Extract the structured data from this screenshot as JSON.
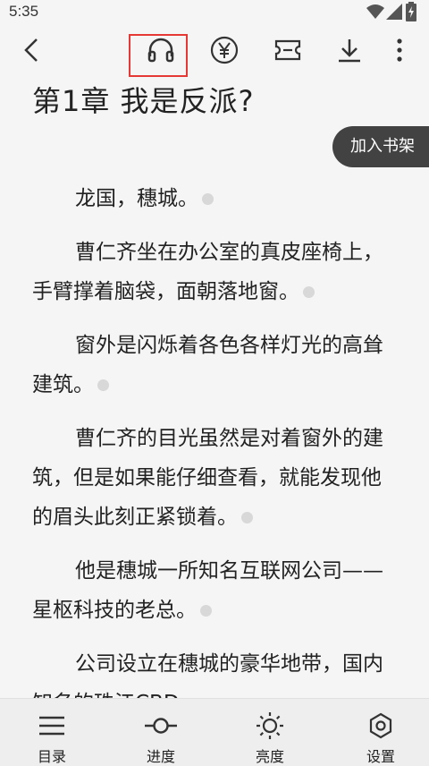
{
  "status_bar": {
    "time": "5:35"
  },
  "toolbar": {
    "buttons": [
      "back-icon",
      "headphones-icon",
      "yuan-icon",
      "ticket-icon",
      "download-icon",
      "more-icon"
    ]
  },
  "chapter": {
    "title": "第1章 我是反派?"
  },
  "add_to_shelf": "加入书架",
  "paragraphs": [
    "龙国，穗城。",
    "曹仁齐坐在办公室的真皮座椅上，手臂撑着脑袋，面朝落地窗。",
    "窗外是闪烁着各色各样灯光的高耸建筑。",
    "曹仁齐的目光虽然是对着窗外的建筑，但是如果能仔细查看，就能发现他的眉头此刻正紧锁着。",
    "他是穗城一所知名互联网公司——星枢科技的老总。",
    "公司设立在穗城的豪华地带，国内知名的珠江CBD。"
  ],
  "bottom_nav": {
    "toc": "目录",
    "progress": "进度",
    "brightness": "亮度",
    "settings": "设置"
  },
  "colors": {
    "highlight": "#e53935",
    "pill_bg": "#424242",
    "page_bg": "#f5f5f5"
  }
}
